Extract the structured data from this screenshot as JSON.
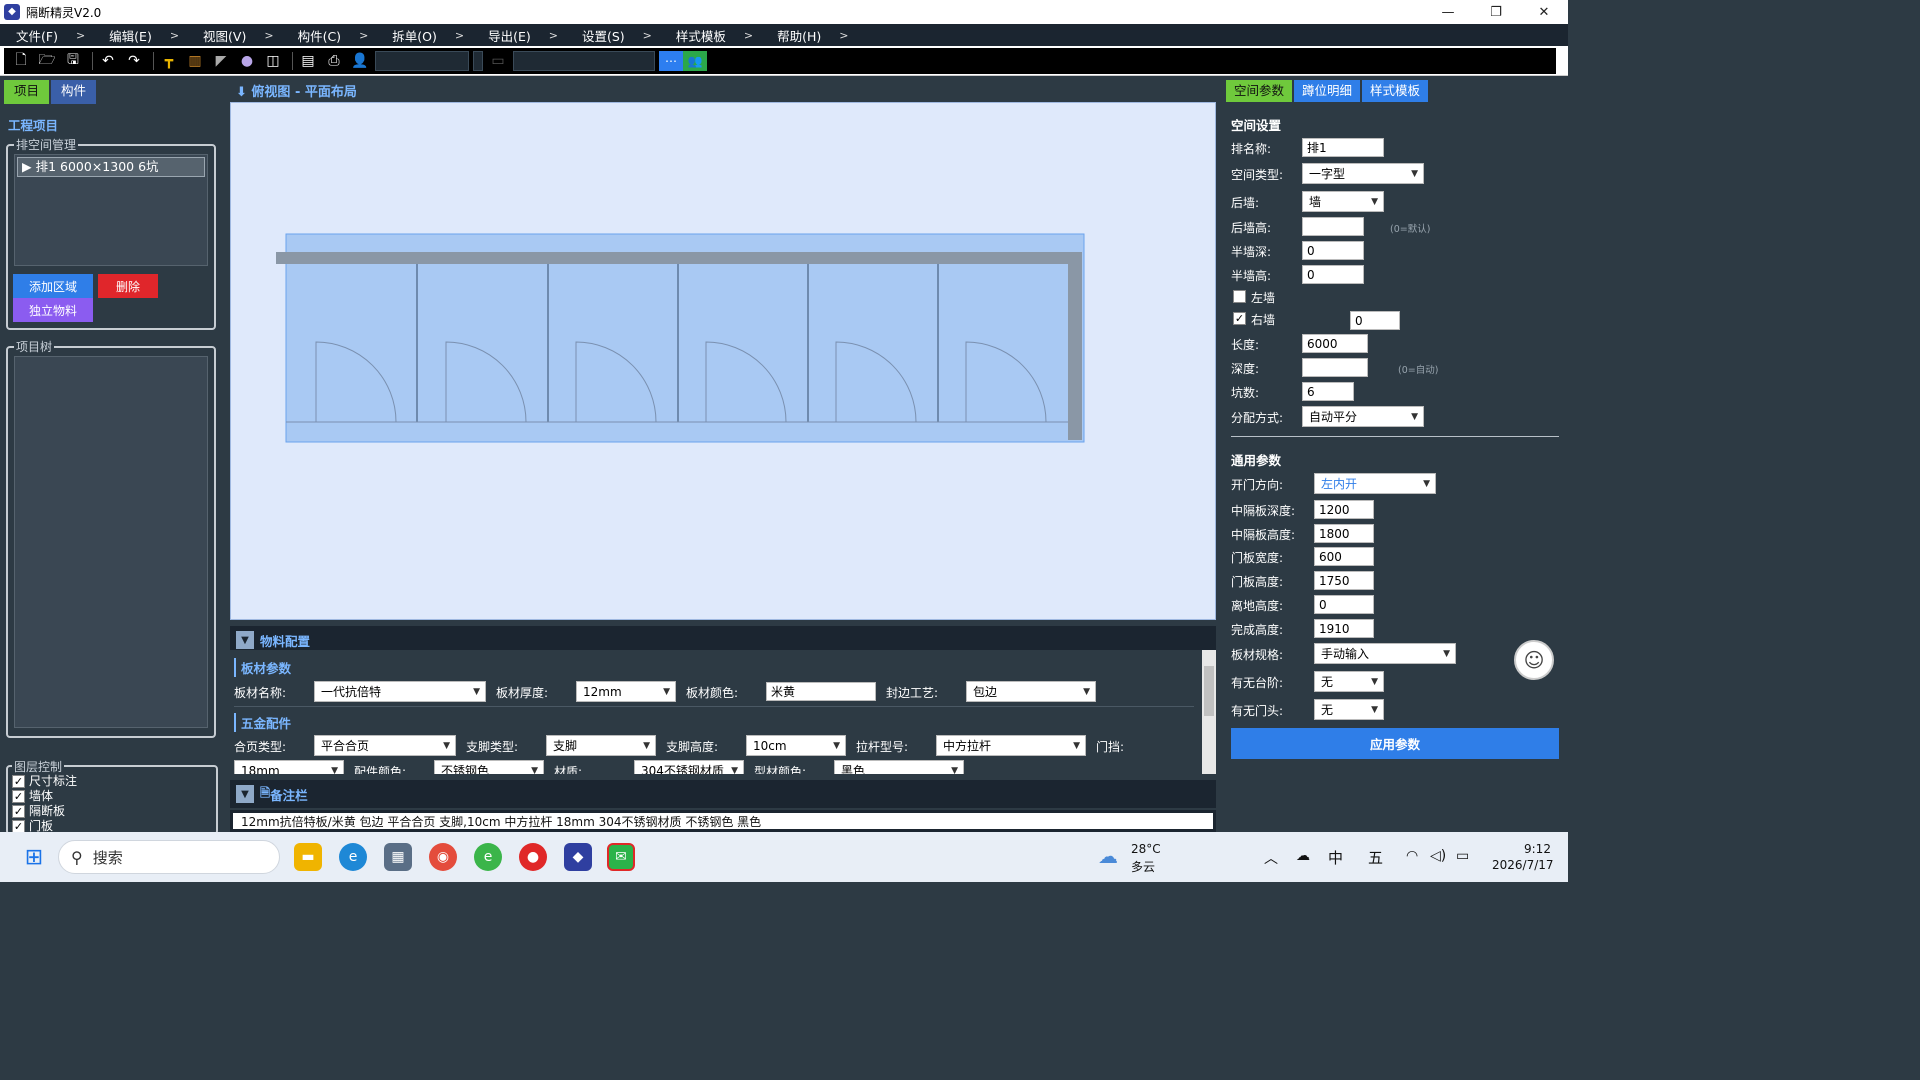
{
  "window": {
    "title": "隔断精灵V2.0",
    "minimize": "—",
    "restore": "❐",
    "close": "✕"
  },
  "menu": [
    "文件(F)",
    "编辑(E)",
    "视图(V)",
    "构件(C)",
    "拆单(O)",
    "导出(E)",
    "设置(S)",
    "样式模板",
    "帮助(H)"
  ],
  "left": {
    "tabs": [
      "项目",
      "构件"
    ],
    "section_title": "工程项目",
    "space_group": "排空间管理",
    "space_item": "▶ 排1  6000×1300 6坑",
    "buttons": {
      "add_area": "添加区域",
      "delete": "删除",
      "independent": "独立物料"
    },
    "tree_group": "项目树",
    "layer_group": "图层控制",
    "layers": [
      "尺寸标注",
      "墙体",
      "隔断板",
      "门板"
    ]
  },
  "center": {
    "view_title": "⬇ 俯视图 - 平面布局",
    "material_panel": "物料配置",
    "board_params": "板材参数",
    "board_name_label": "板材名称:",
    "board_name": "一代抗倍特",
    "board_thick_label": "板材厚度:",
    "board_thick": "12mm",
    "board_color_label": "板材颜色:",
    "board_color": "米黄",
    "edge_label": "封边工艺:",
    "edge": "包边",
    "hardware": "五金配件",
    "hinge_label": "合页类型:",
    "hinge": "平合合页",
    "foot_label": "支脚类型:",
    "foot": "支脚",
    "foot_h_label": "支脚高度:",
    "foot_h": "10cm",
    "rod_label": "拉杆型号:",
    "rod": "中方拉杆",
    "stop_label": "门挡:",
    "row3": [
      "18mm",
      "配件颜色:",
      "不锈钢色",
      "材质:",
      "304不锈钢材质",
      "型材颜色:",
      "黑色"
    ],
    "note_panel": "备注栏",
    "note": "12mm抗倍特板/米黄    包边    平合合页    支脚,10cm    中方拉杆    18mm    304不锈钢材质    不锈钢色    黑色"
  },
  "right": {
    "tabs": [
      "空间参数",
      "蹲位明细",
      "样式模板"
    ],
    "space_settings": "空间设置",
    "row_name_label": "排名称:",
    "row_name": "排1",
    "space_type_label": "空间类型:",
    "space_type": "一字型",
    "back_wall_label": "后墙:",
    "back_wall": "墙",
    "back_wall_h_label": "后墙高:",
    "back_wall_h": "",
    "back_wall_hint": "(0=默认)",
    "half_wall_d_label": "半墙深:",
    "half_wall_d": "0",
    "half_wall_h_label": "半墙高:",
    "half_wall_h": "0",
    "left_wall": "左墙",
    "right_wall": "右墙",
    "right_wall_val": "0",
    "length_label": "长度:",
    "length": "6000",
    "depth_label": "深度:",
    "depth": "",
    "depth_hint": "(0=自动)",
    "pits_label": "坑数:",
    "pits": "6",
    "dist_label": "分配方式:",
    "dist": "自动平分",
    "common": "通用参数",
    "door_dir_label": "开门方向:",
    "door_dir": "左内开",
    "mid_depth_label": "中隔板深度:",
    "mid_depth": "1200",
    "mid_height_label": "中隔板高度:",
    "mid_height": "1800",
    "door_w_label": "门板宽度:",
    "door_w": "600",
    "door_h_label": "门板高度:",
    "door_h": "1750",
    "ground_label": "离地高度:",
    "ground": "0",
    "finish_label": "完成高度:",
    "finish": "1910",
    "spec_label": "板材规格:",
    "spec": "手动输入",
    "step_label": "有无台阶:",
    "step": "无",
    "door_head_label": "有无门头:",
    "door_head": "无",
    "apply": "应用参数"
  },
  "taskbar": {
    "search": "搜索",
    "weather_temp": "28°C",
    "weather_desc": "多云",
    "ime1": "中",
    "ime2": "五",
    "time": "9:12",
    "date": "2026/7/17"
  }
}
